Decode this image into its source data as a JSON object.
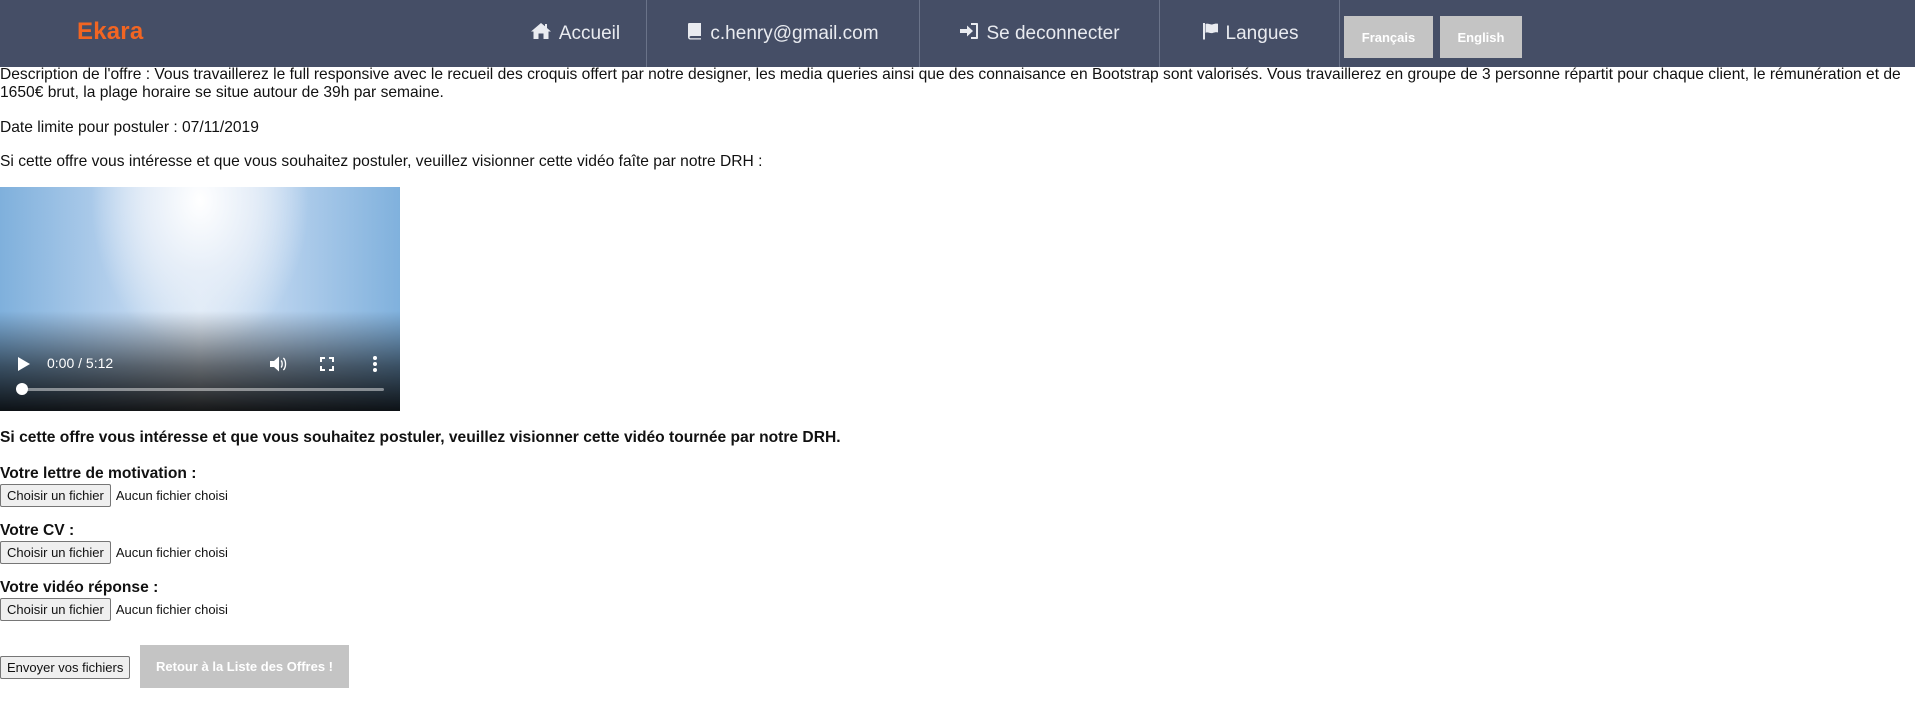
{
  "navbar": {
    "brand": "Ekara",
    "items": [
      {
        "label": "Accueil",
        "icon": "home-icon"
      },
      {
        "label": "c.henry@gmail.com",
        "icon": "book-icon"
      },
      {
        "label": "Se deconnecter",
        "icon": "sign-in-icon"
      },
      {
        "label": "Langues",
        "icon": "flag-icon"
      }
    ],
    "languages": [
      "Français",
      "English"
    ],
    "colors": {
      "background": "#454e66",
      "brand": "#f26522",
      "lang_button": "#c4c4c4"
    }
  },
  "offer": {
    "description": "Description de l'offre : Vous travaillerez le full responsive avec le recueil des croquis offert par notre designer, les media queries ainsi que des connaisance en Bootstrap sont valorisés. Vous travaillerez en groupe de 3 personne répartit pour chaque client, le rémunération et de 1650€ brut, la plage horaire se situe autour de 39h par semaine.",
    "deadline": "Date limite pour postuler : 07/11/2019",
    "video_intro": "Si cette offre vous intéresse et que vous souhaitez postuler, veuillez visionner cette vidéo faîte par notre DRH :"
  },
  "video": {
    "time": "0:00 / 5:12",
    "progress": 0,
    "icons": [
      "play-icon",
      "volume-icon",
      "fullscreen-icon",
      "more-vert-icon"
    ]
  },
  "form": {
    "heading": "Si cette offre vous intéresse et que vous souhaitez postuler, veuillez visionner cette vidéo tournée par notre DRH.",
    "fields": [
      {
        "label": "Votre lettre de motivation :",
        "button": "Choisir un fichier",
        "status": "Aucun fichier choisi"
      },
      {
        "label": "Votre CV :",
        "button": "Choisir un fichier",
        "status": "Aucun fichier choisi"
      },
      {
        "label": "Votre vidéo réponse :",
        "button": "Choisir un fichier",
        "status": "Aucun fichier choisi"
      }
    ],
    "submit": "Envoyer vos fichiers",
    "back": "Retour à la Liste des Offres !"
  }
}
